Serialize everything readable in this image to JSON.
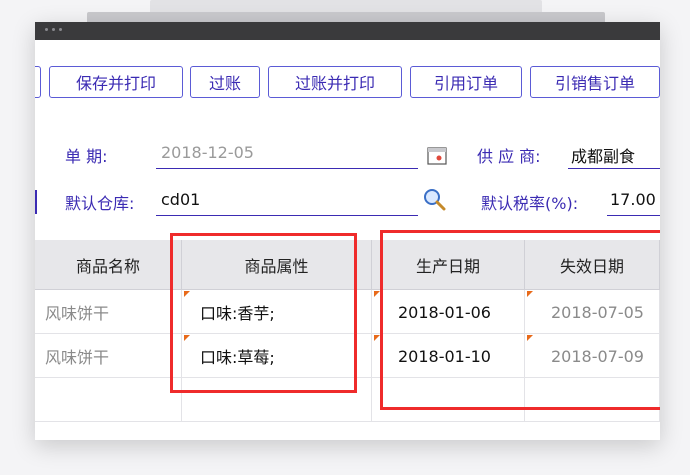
{
  "toolbar": {
    "buttons": [
      "保存并打印",
      "过账",
      "过账并打印",
      "引用订单",
      "引销售订单"
    ]
  },
  "form": {
    "date_label": "单    期:",
    "date_value": "2018-12-05",
    "supplier_label": "供 应 商:",
    "supplier_value": "成都副食",
    "warehouse_label": "默认仓库:",
    "warehouse_value": "cd01",
    "taxrate_label": "默认税率(%):",
    "taxrate_value": "17.00"
  },
  "grid": {
    "headers": [
      "商品名称",
      "商品属性",
      "生产日期",
      "失效日期"
    ],
    "rows": [
      {
        "name": "风味饼干",
        "attr": "口味:香芋;",
        "prod_date": "2018-01-06",
        "exp_date": "2018-07-05"
      },
      {
        "name": "风味饼干",
        "attr": "口味:草莓;",
        "prod_date": "2018-01-10",
        "exp_date": "2018-07-09"
      }
    ]
  },
  "colors": {
    "accent": "#3b2bb3",
    "highlight_box": "#ef2b2b",
    "titlebar": "#3a3a3c"
  },
  "icons": [
    "calendar-icon",
    "search-icon"
  ]
}
